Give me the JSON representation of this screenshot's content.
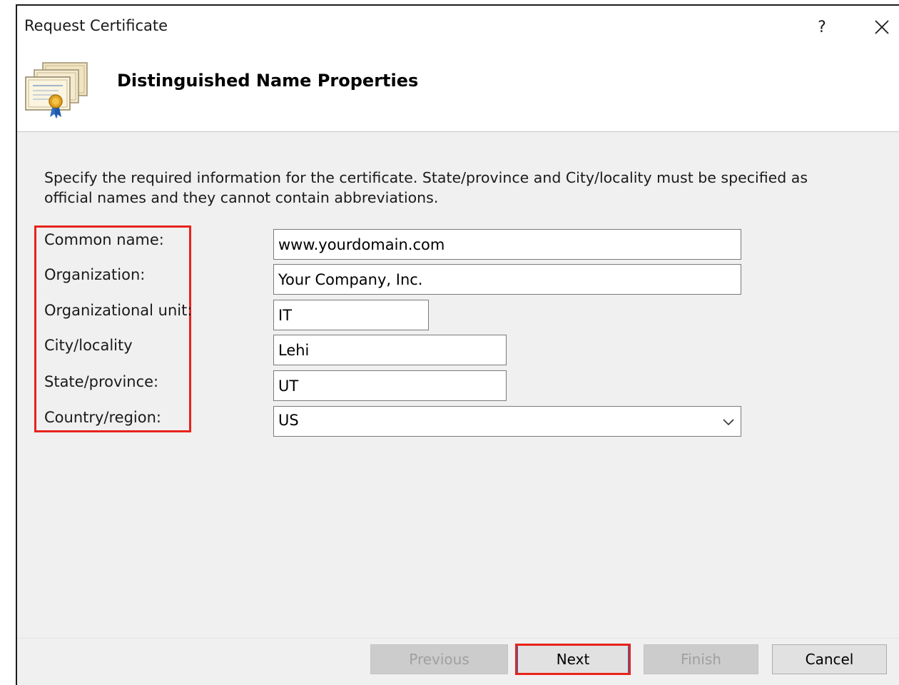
{
  "window": {
    "title": "Request Certificate",
    "help_label": "?",
    "page_heading": "Distinguished Name Properties"
  },
  "instructions": "Specify the required information for the certificate. State/province and City/locality must be specified as official names and they cannot contain abbreviations.",
  "fields": {
    "common_name": {
      "label": "Common name:",
      "value": "www.yourdomain.com"
    },
    "organization": {
      "label": "Organization:",
      "value": "Your Company, Inc."
    },
    "organizational_unit": {
      "label": "Organizational unit:",
      "value": "IT"
    },
    "city": {
      "label": "City/locality",
      "value": "Lehi"
    },
    "state": {
      "label": "State/province:",
      "value": "UT"
    },
    "country": {
      "label": "Country/region:",
      "value": "US"
    }
  },
  "buttons": {
    "previous": "Previous",
    "next": "Next",
    "finish": "Finish",
    "cancel": "Cancel"
  },
  "colors": {
    "highlight": "#e8231c",
    "focus_border": "#0078d7",
    "dialog_background": "#f0f0f0"
  },
  "icons": {
    "header": "certificate-stack-icon",
    "close": "close-icon",
    "dropdown": "chevron-down-icon"
  }
}
